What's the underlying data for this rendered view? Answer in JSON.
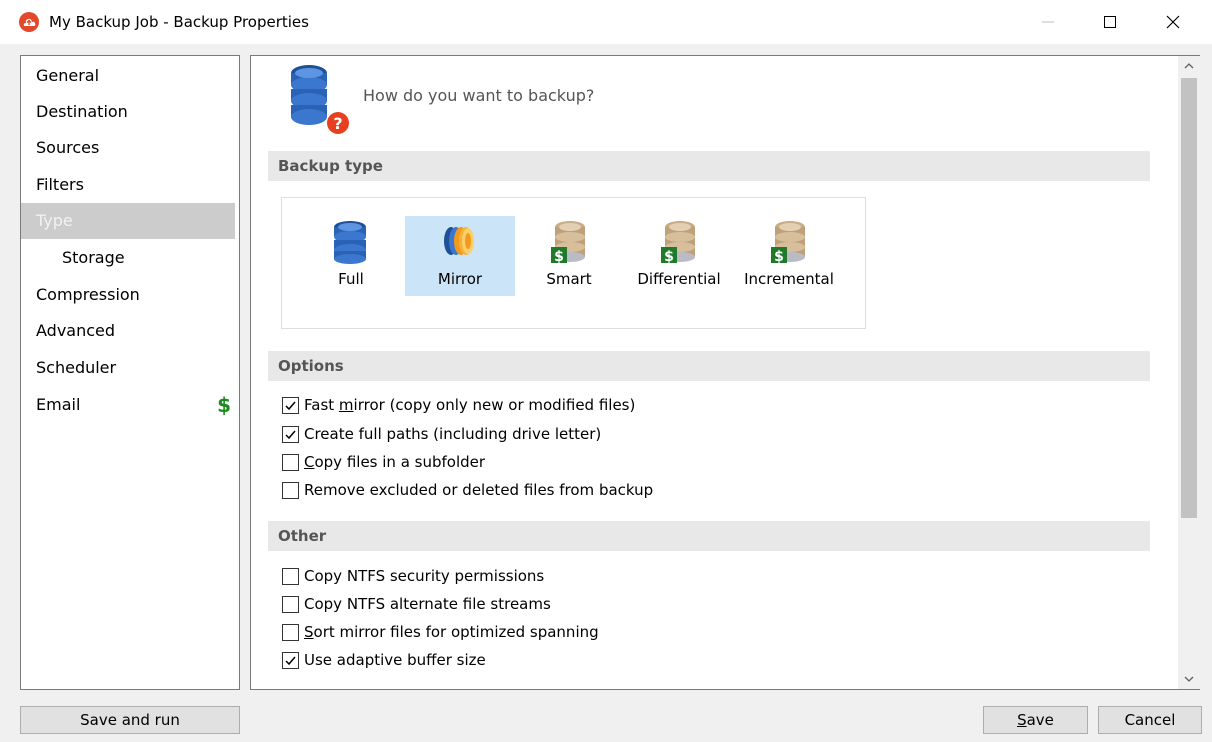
{
  "window": {
    "title": "My Backup Job - Backup Properties",
    "controls": [
      "minimize",
      "maximize",
      "close"
    ]
  },
  "sidebar": {
    "items": [
      {
        "label": "General",
        "selected": false
      },
      {
        "label": "Destination",
        "selected": false
      },
      {
        "label": "Sources",
        "selected": false
      },
      {
        "label": "Filters",
        "selected": false
      },
      {
        "label": "Type",
        "selected": true
      },
      {
        "label": "Storage",
        "selected": false,
        "indented": true
      },
      {
        "label": "Compression",
        "selected": false
      },
      {
        "label": "Advanced",
        "selected": false
      },
      {
        "label": "Scheduler",
        "selected": false
      },
      {
        "label": "Email",
        "selected": false,
        "badge": "$"
      }
    ]
  },
  "main": {
    "header_text": "How do you want to backup?",
    "sections": {
      "backup_type": "Backup type",
      "options": "Options",
      "other": "Other"
    },
    "backup_types": [
      {
        "label": "Full",
        "icon": "database-blue-icon",
        "selected": false
      },
      {
        "label": "Mirror",
        "icon": "mirror-disks-icon",
        "selected": true
      },
      {
        "label": "Smart",
        "icon": "database-dollar-icon",
        "selected": false
      },
      {
        "label": "Differential",
        "icon": "database-dollar-icon",
        "selected": false
      },
      {
        "label": "Incremental",
        "icon": "database-dollar-icon",
        "selected": false
      }
    ],
    "options": [
      {
        "pre": "Fast ",
        "u": "m",
        "post": "irror (copy only new or modified files)",
        "checked": true
      },
      {
        "pre": "Create full paths (including drive letter)",
        "u": "",
        "post": "",
        "checked": true
      },
      {
        "pre": "",
        "u": "C",
        "post": "opy files in a subfolder",
        "checked": false
      },
      {
        "pre": "Remove excluded or deleted files from backup",
        "u": "",
        "post": "",
        "checked": false
      }
    ],
    "other": [
      {
        "pre": "Copy NTFS security permissions",
        "u": "",
        "post": "",
        "checked": false
      },
      {
        "pre": "Copy NTFS alternate file streams",
        "u": "",
        "post": "",
        "checked": false
      },
      {
        "pre": "",
        "u": "S",
        "post": "ort mirror files for optimized spanning",
        "checked": false
      },
      {
        "pre": "Use adaptive buffer size",
        "u": "",
        "post": "",
        "checked": true
      }
    ]
  },
  "buttons": {
    "save_and_run": "Save and run",
    "save_u": "S",
    "save_rest": "ave",
    "cancel": "Cancel"
  },
  "colors": {
    "selected_nav_bg": "#cccccc",
    "selected_type_bg": "#cce4f7",
    "dollar_green": "#1d8a1d",
    "app_icon_red": "#e2482b"
  }
}
